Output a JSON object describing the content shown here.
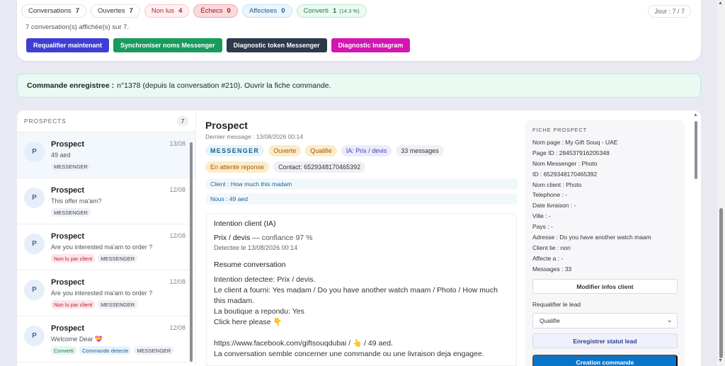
{
  "stats": [
    {
      "label": "Conversations",
      "count": "7",
      "style": "plain"
    },
    {
      "label": "Ouvertes",
      "count": "7",
      "style": "plain"
    },
    {
      "label": "Non lus",
      "count": "4",
      "style": "red"
    },
    {
      "label": "Échecs",
      "count": "0",
      "style": "red2"
    },
    {
      "label": "Affectees",
      "count": "0",
      "style": "blue"
    },
    {
      "label": "Converti",
      "count": "1",
      "sub": "(14.3 %)",
      "style": "green"
    }
  ],
  "day_label": "Jour : 7 / 7",
  "shown_text": "7 conversation(s) affichée(s) sur 7.",
  "actions": {
    "requalify": "Requalifier maintenant",
    "sync_names": "Synchroniser noms Messenger",
    "diag_messenger": "Diagnostic token Messenger",
    "diag_instagram": "Diagnostic Instagram"
  },
  "banner": {
    "label": "Commande enregistree :",
    "text": "n°1378 (depuis la conversation #210). Ouvrir la fiche commande."
  },
  "prospects": {
    "title": "PROSPECTS",
    "count": "7",
    "items": [
      {
        "initial": "P",
        "name": "Prospect",
        "date": "13/08",
        "preview": "49 aed",
        "tags": [
          {
            "text": "MESSENGER",
            "style": "grey"
          }
        ]
      },
      {
        "initial": "P",
        "name": "Prospect",
        "date": "12/08",
        "preview": "This offer ma'am?",
        "tags": [
          {
            "text": "MESSENGER",
            "style": "grey"
          }
        ]
      },
      {
        "initial": "P",
        "name": "Prospect",
        "date": "12/08",
        "preview": "Are you interested ma'am to order ?",
        "tags": [
          {
            "text": "Non lu par client",
            "style": "red"
          },
          {
            "text": "MESSENGER",
            "style": "grey"
          }
        ]
      },
      {
        "initial": "P",
        "name": "Prospect",
        "date": "12/08",
        "preview": "Are you interested ma'am to order ?",
        "tags": [
          {
            "text": "Non lu par client",
            "style": "red"
          },
          {
            "text": "MESSENGER",
            "style": "grey"
          }
        ]
      },
      {
        "initial": "P",
        "name": "Prospect",
        "date": "12/08",
        "preview": "Welcome Dear 💝",
        "tags": [
          {
            "text": "Converti",
            "style": "green"
          },
          {
            "text": "Commande detecte",
            "style": "blue"
          },
          {
            "text": "MESSENGER",
            "style": "grey"
          }
        ]
      }
    ]
  },
  "detail": {
    "title": "Prospect",
    "last_message": "Dernier message : 13/08/2026 00:14",
    "badges": {
      "channel": "MESSENGER",
      "status": "Ouverte",
      "qualif": "Qualifie",
      "ia": "IA: Prix / devis",
      "messages": "33 messages",
      "waiting": "En attente reponse",
      "contact": "Contact: 6529348170465392"
    },
    "client_line": "Client : How much this madam",
    "us_line": "Nous : 49 aed",
    "ai": {
      "title": "Intention client (IA)",
      "intent": "Prix / devis",
      "confidence": "— confiance 97 %",
      "detected": "Detectee le 13/08/2026 00:14",
      "summary_title": "Resume conversation",
      "summary_lines": [
        "Intention detectee: Prix / devis.",
        "Le client a fourni: Yes madam / Do you have another watch maam / Photo / How much this madam.",
        "La boutique a repondu: Yes",
        "Click here please 👇",
        "",
        "https://www.facebook.com/giftsouqdubai / 👆 / 49 aed.",
        "La conversation semble concerner une commande ou une livraison deja engagee."
      ]
    }
  },
  "fiche": {
    "title": "FICHE PROSPECT",
    "rows": [
      "Nom page : My Gift Souq - UAE",
      "Page ID : 284537916205348",
      "Nom Messenger : Photo",
      "ID : 6529348170465392",
      "Nom client : Photo",
      "Telephone : -",
      "Date livraison : -",
      "Ville : -",
      "Pays : -",
      "Adresse : Do you have another watch maam",
      "Client lie : non",
      "Affecte a : -",
      "Messages : 33"
    ],
    "edit_button": "Modifier infos client",
    "requalify_label": "Requalifier le lead",
    "select_value": "Qualifie",
    "save_button": "Enregistrer statut lead",
    "create_button": "Creation commande"
  },
  "colors": {
    "primary": "#3f3ed4",
    "success": "#199b5c",
    "dark": "#2c3a4b",
    "instagram": "#d315b2",
    "create": "#0a74c9"
  }
}
